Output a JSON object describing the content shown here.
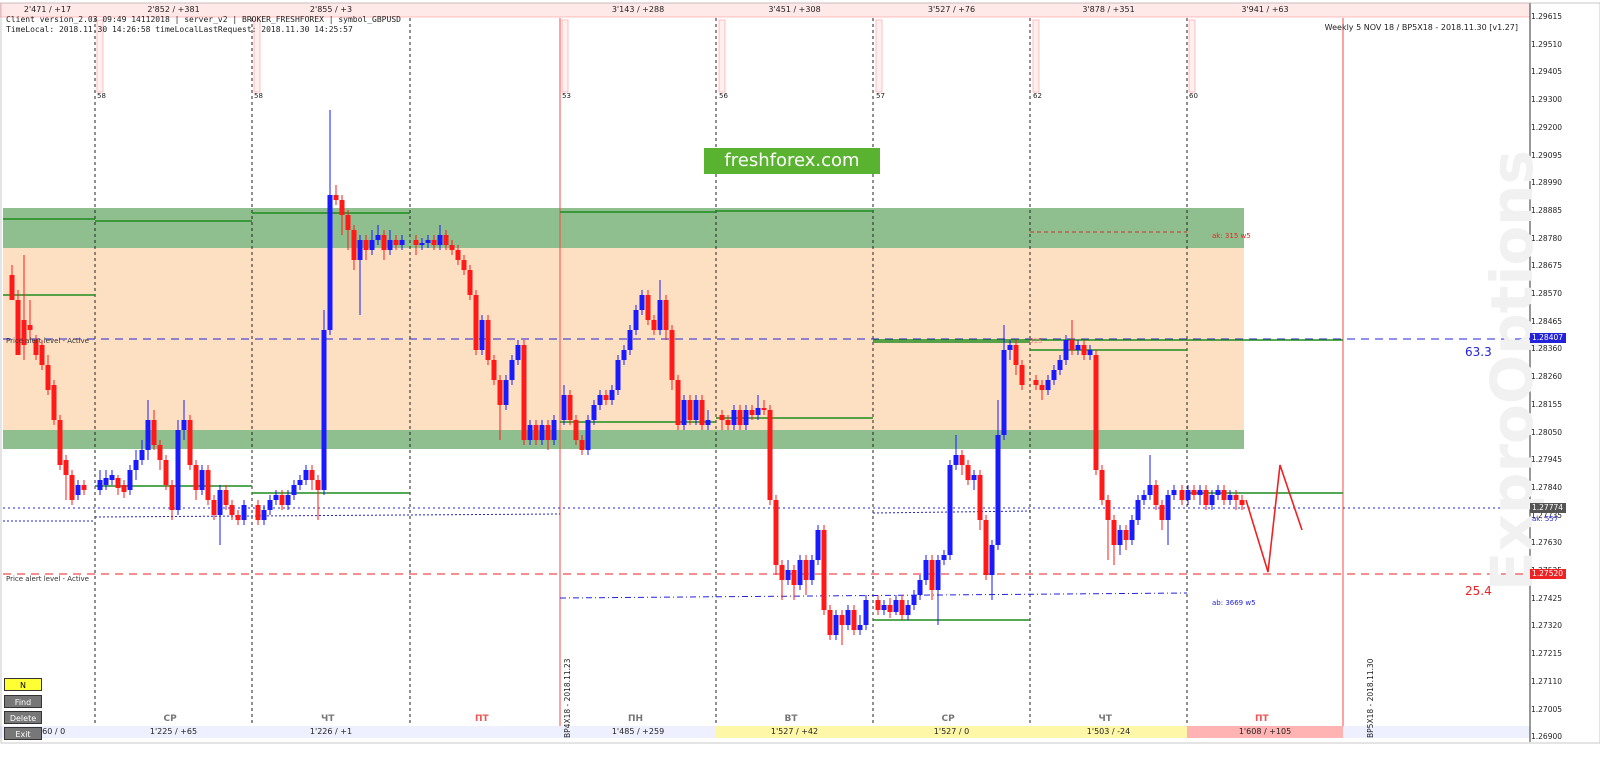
{
  "symbol": "GBPUSD",
  "info_lines": [
    "Client version_2.03 09:49 14112018 | server_v2 | BROKER_FRESHFOREX | symbol_GBPUSD",
    "TimeLocal: 2018.11.30 14:26:58 timeLocalLastRequest: 2018.11.30 14:25:57"
  ],
  "title_right": "Weekly 5 NOV 18 / BP5X18 - 2018.11.30 [v1.27]",
  "watermark": "freshforex.com",
  "ghost_text": "ExproOptions",
  "top_bar": [
    "2'471 / +17",
    "2'852 / +381",
    "2'855 / +3",
    "3'143 / +288",
    "3'451 / +308",
    "3'527 / +76",
    "3'878 / +351",
    "3'941 / +63"
  ],
  "marker_counts": [
    "58",
    "58",
    "53",
    "56",
    "57",
    "62",
    "60"
  ],
  "bottom_bar": [
    "1'160 / 0",
    "1'225 / +65",
    "1'226 / +1",
    "1'485 / +259",
    "1'527 / +42",
    "1'527 / 0",
    "1'503 / -24",
    "1'608 / +105"
  ],
  "day_labels": [
    "СР",
    "ЧТ",
    "ПТ",
    "ПН",
    "ВТ",
    "СР",
    "ЧТ",
    "ПТ"
  ],
  "expiry_labels": [
    "BP4X18 - 2018.11.23",
    "BP5X18 - 2018.11.30"
  ],
  "alert_label": "Price alert level - Active",
  "levels": {
    "upper_label": "63.3",
    "lower_label": "25.4"
  },
  "annotations": {
    "ak_upper": "ak: 315 w5",
    "ak_mid": "ak: 557",
    "ak_lower": "ab: 3669 w5",
    "bar_note": "315"
  },
  "price_axis": [
    "1.29615",
    "1.29510",
    "1.29405",
    "1.29300",
    "1.29200",
    "1.29095",
    "1.28990",
    "1.28885",
    "1.28780",
    "1.28675",
    "1.28570",
    "1.28465",
    "1.28360",
    "1.28260",
    "1.28155",
    "1.28050",
    "1.27945",
    "1.27840",
    "1.27735",
    "1.27630",
    "1.27525",
    "1.27425",
    "1.27320",
    "1.27215",
    "1.27110",
    "1.27005",
    "1.26900"
  ],
  "price_tags": [
    {
      "value": "1.28407",
      "color": "#2222dd"
    },
    {
      "value": "1.27774",
      "color": "#555555"
    },
    {
      "value": "1.27520",
      "color": "#ee2222"
    }
  ],
  "buttons": [
    "N",
    "Find",
    "Delete",
    "Exit"
  ],
  "colors": {
    "up": "#1a1aff",
    "down": "#ff1a1a",
    "zone_green": "#8fbf8f",
    "zone_peach": "#fde0c2",
    "level_blue": "#2222dd",
    "level_red": "#ee2222"
  }
}
